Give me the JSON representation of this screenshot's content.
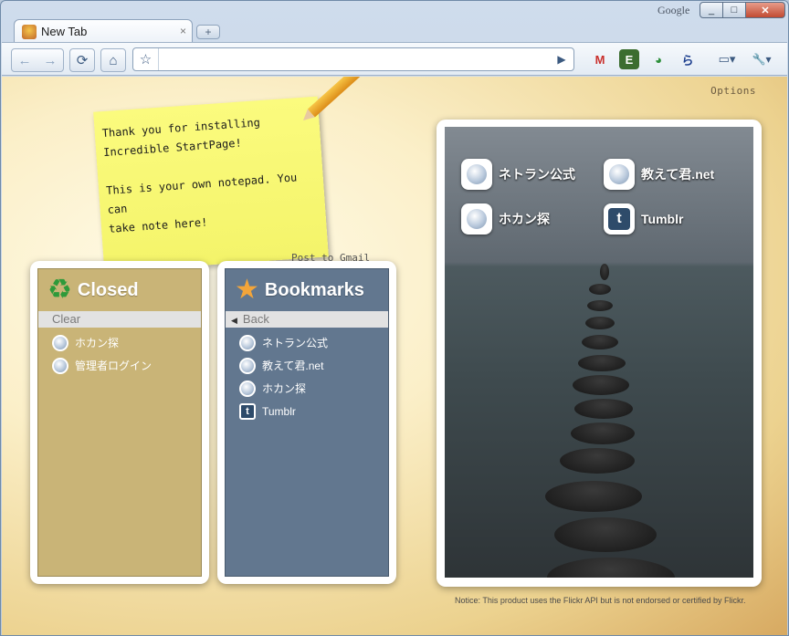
{
  "window": {
    "brand": "Google",
    "controls": {
      "minimize": "_",
      "maximize": "□",
      "close": "✕"
    }
  },
  "tab": {
    "title": "New Tab",
    "close": "×",
    "new_tab": "+"
  },
  "toolbar": {
    "back": "←",
    "forward": "→",
    "reload": "⟳",
    "home": "⌂",
    "star": "☆",
    "go": "▶",
    "address": {
      "value": "",
      "placeholder": ""
    },
    "extensions": [
      "M",
      "E",
      "◕",
      "ら"
    ],
    "page_menu": "▭▾",
    "wrench_menu": "🔧▾"
  },
  "content": {
    "options_label": "Options",
    "note": {
      "text": "Thank you for installing\nIncredible StartPage!\n\nThis is your own notepad. You can\ntake note here!",
      "post_label": "Post to Gmail"
    },
    "closed_panel": {
      "title": "Closed",
      "bar_label": "Clear",
      "items": [
        "ホカン探",
        "管理者ログイン"
      ]
    },
    "bookmarks_panel": {
      "title": "Bookmarks",
      "bar_label": "Back",
      "items": [
        "ネトラン公式",
        "教えて君.net",
        "ホカン探",
        "Tumblr"
      ]
    },
    "speed_dial": {
      "tiles": [
        "ネトラン公式",
        "教えて君.net",
        "ホカン探",
        "Tumblr"
      ]
    },
    "notice": "Notice: This product uses the Flickr API but is not endorsed or certified by Flickr."
  },
  "colors": {
    "closed_panel": "#c9b477",
    "bookmarks_panel": "#62778f",
    "note": "#f7f76f"
  }
}
